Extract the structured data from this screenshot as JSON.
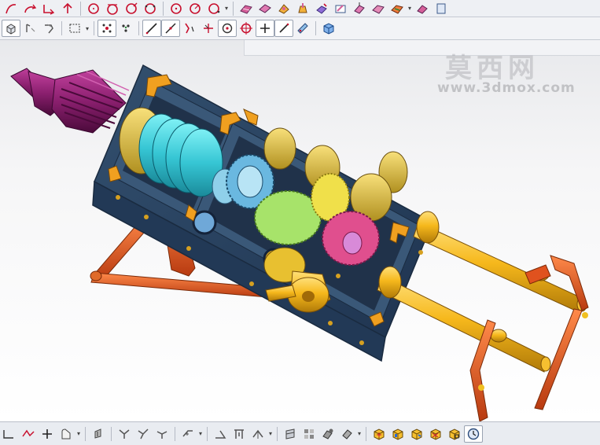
{
  "watermark": {
    "text": "莫西网",
    "url": "www.3dmox.com"
  },
  "toolbars": {
    "top_row": [
      "curve-icon",
      "arc-icon",
      "trim-icon",
      "extend-icon",
      "circle-icon",
      "circle-tangent-icon",
      "circle-point-icon",
      "circle-3pt-icon",
      "ellipse-icon",
      "circle-center-icon",
      "polygon-icon",
      "surface-icon",
      "sweep-icon",
      "loft-icon",
      "blend-icon",
      "extrude-icon",
      "revolve-icon",
      "shell-icon"
    ],
    "second_row": [
      "view-cube-icon",
      "move-icon",
      "rotate-icon",
      "select-box-icon",
      "snap-grid-icon",
      "snap-point-icon",
      "line-icon",
      "line-angle-icon",
      "arc-tool-icon",
      "spline-icon",
      "circle-snap-icon",
      "point-icon",
      "cross-icon",
      "diagonal-icon",
      "measure-icon",
      "solid-cube-icon"
    ],
    "bottom_row": [
      "axis-icon",
      "polyline-icon",
      "plus-icon",
      "shape-icon",
      "fill-icon",
      "fork-icon",
      "fork2-icon",
      "branch-icon",
      "pattern-icon",
      "angle-icon",
      "frame-icon",
      "dimension-icon",
      "wall-icon",
      "grid-blocks-icon",
      "assembly-icon",
      "part-icon",
      "view-iso-icon",
      "view-front-icon",
      "view-top-icon",
      "view-right-icon",
      "view-wire-icon",
      "clock-icon"
    ]
  },
  "colors": {
    "housing": "#283f5c",
    "housing_edge": "#1a2b40",
    "bracket": "#f0a020",
    "shaft": "#f6b81c",
    "coupling": "#8a1f6e",
    "gear_cyan": "#36c6d4",
    "gear_gold": "#c8b030",
    "gear_green": "#a7e36a",
    "gear_pink": "#e04f8e",
    "gear_lightblue": "#8fd0ea",
    "linkage": "#e0521e"
  }
}
